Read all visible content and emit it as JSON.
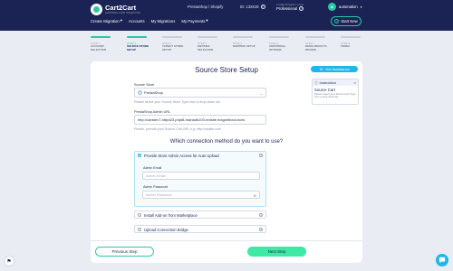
{
  "header": {
    "logo_name": "Cart2Cart",
    "logo_tagline": "SHOPPING CART MIGRATION",
    "migration_path": "PrestaShop / Shopify",
    "migration_id": "ID: 132619",
    "loyalty_title": "Loyalty Program Level",
    "loyalty_value": "Professional",
    "user_initial": "A",
    "user_name": "automation",
    "nav": [
      {
        "label": "Create Migration",
        "has_caret": true
      },
      {
        "label": "Accounts",
        "has_caret": false
      },
      {
        "label": "My Migrations",
        "has_caret": false
      },
      {
        "label": "My Payments",
        "has_caret": true
      }
    ],
    "start_new_label": "Start New"
  },
  "steps": [
    {
      "num": "STEP 1",
      "label": "ACCOUNT SELECTION",
      "state": "done"
    },
    {
      "num": "STEP 2",
      "label": "SOURCE STORE SETUP",
      "state": "active"
    },
    {
      "num": "STEP 3",
      "label": "TARGET STORE SETUP",
      "state": "todo"
    },
    {
      "num": "STEP 4",
      "label": "ENTITIES SELECTION",
      "state": "todo"
    },
    {
      "num": "STEP 5",
      "label": "MAPPING SETUP",
      "state": "todo"
    },
    {
      "num": "STEP 6",
      "label": "ADDITIONAL OPTIONS",
      "state": "todo"
    },
    {
      "num": "STEP 7",
      "label": "DEMO RESULTS REVIEW",
      "state": "todo"
    },
    {
      "num": "STEP 8",
      "label": "FINISH",
      "state": "todo"
    }
  ],
  "main": {
    "title": "Source Store Setup",
    "get_assistance": "Get Assistance",
    "instruction": {
      "header": "Instruction",
      "title": "Source Cart",
      "text": "Please select your Source Cart Type from a drop-down list."
    },
    "source_store_label": "Source Store",
    "source_store_value": "PrestaShop",
    "source_store_hint": "Please select your Source Store Type from a drop-down list",
    "url_label": "PrestaShop Admin URL",
    "url_value": "http://cartdev7-httpd23-phpt8-mariadb103.redsite.magneticsources",
    "url_hint": "Please, provide your Source Cart URL e.g. http://mysite.com",
    "question": "Which connection method do you want to use?",
    "options": [
      {
        "label": "Provide Store Admin Access for Auto Upload",
        "selected": true
      },
      {
        "label": "Install Add-on from Marketplace",
        "selected": false
      },
      {
        "label": "Upload Connection Bridge",
        "selected": false
      }
    ],
    "admin_email_label": "Admin Email",
    "admin_email_placeholder": "Admin Email",
    "admin_password_label": "Admin Password",
    "admin_password_placeholder": "Admin Password",
    "prev_label": "Previous Step",
    "next_label": "Next Step"
  },
  "colors": {
    "header_bg": "#1b2354",
    "accent_green": "#2bc6a6",
    "accent_blue": "#22b5e8",
    "next_btn": "#3ee8a5"
  }
}
